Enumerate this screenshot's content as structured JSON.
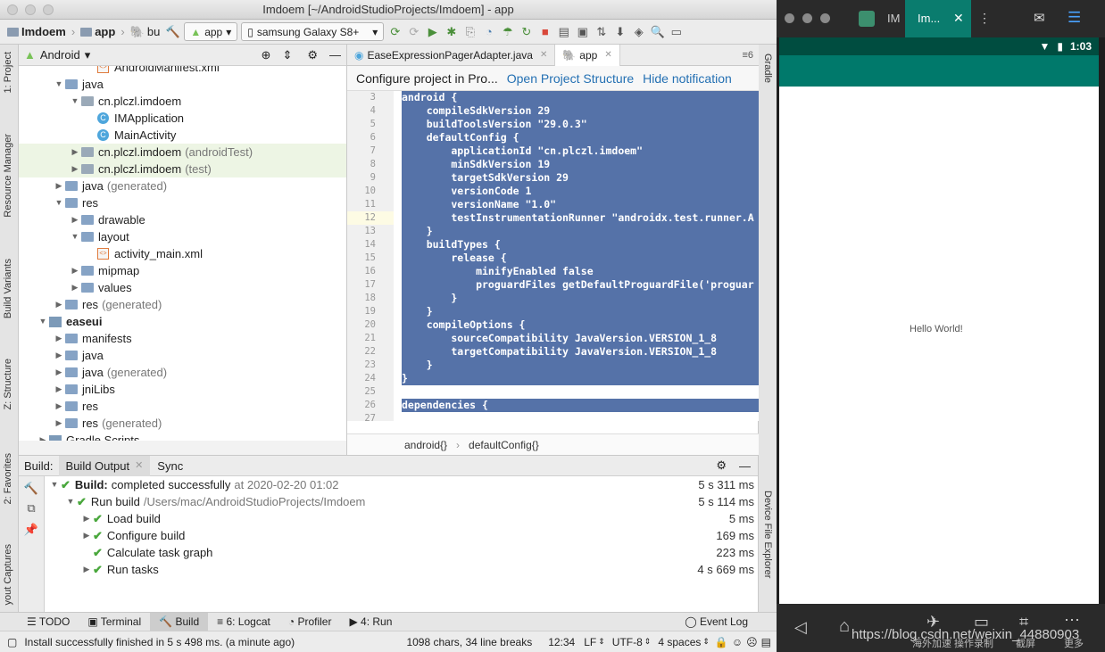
{
  "window": {
    "title": "Imdoem [~/AndroidStudioProjects/Imdoem] - app"
  },
  "toolbar": {
    "crumb_project": "Imdoem",
    "crumb_app": "app",
    "crumb_bu": "bu",
    "config_combo": "app",
    "device_combo": "samsung Galaxy S8+"
  },
  "left_strip": {
    "project": "1: Project",
    "resource_manager": "Resource Manager",
    "build_variants": "Build Variants",
    "structure": "Z: Structure",
    "favorites": "2: Favorites",
    "layout_captures": "yout Captures"
  },
  "right_strip": {
    "gradle": "Gradle",
    "device_file_explorer": "Device File Explorer"
  },
  "project_panel": {
    "view_mode": "Android",
    "tree": [
      {
        "label": "AndroidManifest.xml",
        "suffix": "",
        "indent": 3,
        "icon": "xml",
        "arrow": ""
      },
      {
        "label": "java",
        "suffix": "",
        "indent": 1,
        "icon": "folder",
        "arrow": "▼"
      },
      {
        "label": "cn.plczl.imdoem",
        "suffix": "",
        "indent": 2,
        "icon": "pkg",
        "arrow": "▼"
      },
      {
        "label": "IMApplication",
        "suffix": "",
        "indent": 3,
        "icon": "class",
        "arrow": ""
      },
      {
        "label": "MainActivity",
        "suffix": "",
        "indent": 3,
        "icon": "class",
        "arrow": ""
      },
      {
        "label": "cn.plczl.imdoem",
        "suffix": "(androidTest)",
        "indent": 2,
        "icon": "pkg",
        "arrow": "▶",
        "highlight": true
      },
      {
        "label": "cn.plczl.imdoem",
        "suffix": "(test)",
        "indent": 2,
        "icon": "pkg",
        "arrow": "▶",
        "highlight": true
      },
      {
        "label": "java",
        "suffix": "(generated)",
        "indent": 1,
        "icon": "folder",
        "arrow": "▶"
      },
      {
        "label": "res",
        "suffix": "",
        "indent": 1,
        "icon": "folder",
        "arrow": "▼"
      },
      {
        "label": "drawable",
        "suffix": "",
        "indent": 2,
        "icon": "folder",
        "arrow": "▶"
      },
      {
        "label": "layout",
        "suffix": "",
        "indent": 2,
        "icon": "folder",
        "arrow": "▼"
      },
      {
        "label": "activity_main.xml",
        "suffix": "",
        "indent": 3,
        "icon": "xml",
        "arrow": ""
      },
      {
        "label": "mipmap",
        "suffix": "",
        "indent": 2,
        "icon": "folder",
        "arrow": "▶"
      },
      {
        "label": "values",
        "suffix": "",
        "indent": 2,
        "icon": "folder",
        "arrow": "▶"
      },
      {
        "label": "res",
        "suffix": "(generated)",
        "indent": 1,
        "icon": "folder",
        "arrow": "▶"
      },
      {
        "label": "easeui",
        "suffix": "",
        "indent": 0,
        "icon": "module",
        "arrow": "▼",
        "bold": true
      },
      {
        "label": "manifests",
        "suffix": "",
        "indent": 1,
        "icon": "folder",
        "arrow": "▶"
      },
      {
        "label": "java",
        "suffix": "",
        "indent": 1,
        "icon": "folder",
        "arrow": "▶"
      },
      {
        "label": "java",
        "suffix": "(generated)",
        "indent": 1,
        "icon": "folder",
        "arrow": "▶"
      },
      {
        "label": "jniLibs",
        "suffix": "",
        "indent": 1,
        "icon": "folder",
        "arrow": "▶"
      },
      {
        "label": "res",
        "suffix": "",
        "indent": 1,
        "icon": "folder",
        "arrow": "▶"
      },
      {
        "label": "res",
        "suffix": "(generated)",
        "indent": 1,
        "icon": "folder",
        "arrow": "▶"
      },
      {
        "label": "Gradle Scripts",
        "suffix": "",
        "indent": 0,
        "icon": "module",
        "arrow": "▶"
      }
    ]
  },
  "editor": {
    "tabs": [
      {
        "label": "EaseExpressionPagerAdapter.java",
        "active": false
      },
      {
        "label": "app",
        "active": true
      }
    ],
    "tab_count": "6",
    "notification": {
      "text": "Configure project in Pro...",
      "open_link": "Open Project Structure",
      "hide_link": "Hide notification"
    },
    "lines": [
      {
        "n": "3",
        "code": "android {",
        "sel": true
      },
      {
        "n": "4",
        "code": "    compileSdkVersion 29",
        "sel": true
      },
      {
        "n": "5",
        "code": "    buildToolsVersion \"29.0.3\"",
        "sel": true
      },
      {
        "n": "6",
        "code": "    defaultConfig {",
        "sel": true
      },
      {
        "n": "7",
        "code": "        applicationId \"cn.plczl.imdoem\"",
        "sel": true
      },
      {
        "n": "8",
        "code": "        minSdkVersion 19",
        "sel": true
      },
      {
        "n": "9",
        "code": "        targetSdkVersion 29",
        "sel": true
      },
      {
        "n": "10",
        "code": "        versionCode 1",
        "sel": true
      },
      {
        "n": "11",
        "code": "        versionName \"1.0\"",
        "sel": true
      },
      {
        "n": "12",
        "code": "        testInstrumentationRunner \"androidx.test.runner.A",
        "sel": true
      },
      {
        "n": "13",
        "code": "    }",
        "sel": true
      },
      {
        "n": "14",
        "code": "    buildTypes {",
        "sel": true
      },
      {
        "n": "15",
        "code": "        release {",
        "sel": true
      },
      {
        "n": "16",
        "code": "            minifyEnabled false",
        "sel": true
      },
      {
        "n": "17",
        "code": "            proguardFiles getDefaultProguardFile('proguar",
        "sel": true
      },
      {
        "n": "18",
        "code": "        }",
        "sel": true
      },
      {
        "n": "19",
        "code": "    }",
        "sel": true
      },
      {
        "n": "20",
        "code": "    compileOptions {",
        "sel": true
      },
      {
        "n": "21",
        "code": "        sourceCompatibility JavaVersion.VERSION_1_8",
        "sel": true
      },
      {
        "n": "22",
        "code": "        targetCompatibility JavaVersion.VERSION_1_8",
        "sel": true
      },
      {
        "n": "23",
        "code": "    }",
        "sel": true
      },
      {
        "n": "24",
        "code": "}",
        "sel": true
      },
      {
        "n": "25",
        "code": "",
        "sel": false
      },
      {
        "n": "26",
        "code": "dependencies {",
        "sel": true
      },
      {
        "n": "27",
        "code": "",
        "sel": false
      }
    ],
    "current_line": "12",
    "breadcrumb_1": "android{}",
    "breadcrumb_2": "defaultConfig{}"
  },
  "build_panel": {
    "label": "Build:",
    "tab_output": "Build Output",
    "tab_sync": "Sync",
    "rows": [
      {
        "bold": "Build:",
        "text": "completed successfully",
        "extra": "at 2020-02-20 01:02",
        "time": "5 s 311 ms",
        "indent": 0,
        "arrow": "▼"
      },
      {
        "bold": "",
        "text": "Run build",
        "extra": "/Users/mac/AndroidStudioProjects/Imdoem",
        "time": "5 s 114 ms",
        "indent": 1,
        "arrow": "▼"
      },
      {
        "bold": "",
        "text": "Load build",
        "extra": "",
        "time": "5 ms",
        "indent": 2,
        "arrow": "▶"
      },
      {
        "bold": "",
        "text": "Configure build",
        "extra": "",
        "time": "169 ms",
        "indent": 2,
        "arrow": "▶"
      },
      {
        "bold": "",
        "text": "Calculate task graph",
        "extra": "",
        "time": "223 ms",
        "indent": 2,
        "arrow": ""
      },
      {
        "bold": "",
        "text": "Run tasks",
        "extra": "",
        "time": "4 s 669 ms",
        "indent": 2,
        "arrow": "▶"
      }
    ]
  },
  "bottom_tools": {
    "todo": "TODO",
    "terminal": "Terminal",
    "build": "Build",
    "logcat": "6: Logcat",
    "profiler": "Profiler",
    "run": "4: Run",
    "event_log": "Event Log"
  },
  "status": {
    "message": "Install successfully finished in 5 s 498 ms. (a minute ago)",
    "chars": "1098 chars, 34 line breaks",
    "position": "12:34",
    "line_sep": "LF",
    "encoding": "UTF-8",
    "indent": "4 spaces"
  },
  "emulator": {
    "tab_1": "IM",
    "tab_2": "Im...",
    "time": "1:03",
    "hello": "Hello World!",
    "watermark": "https://blog.csdn.net/weixin_44880903",
    "overlay_1": "海外加速 操作录制",
    "overlay_2": "截屏",
    "overlay_3": "更多"
  },
  "colors": {
    "selection": "#5572a8",
    "accent_green": "#49a73c",
    "link": "#2470b3",
    "emulator_status": "#004d40"
  }
}
